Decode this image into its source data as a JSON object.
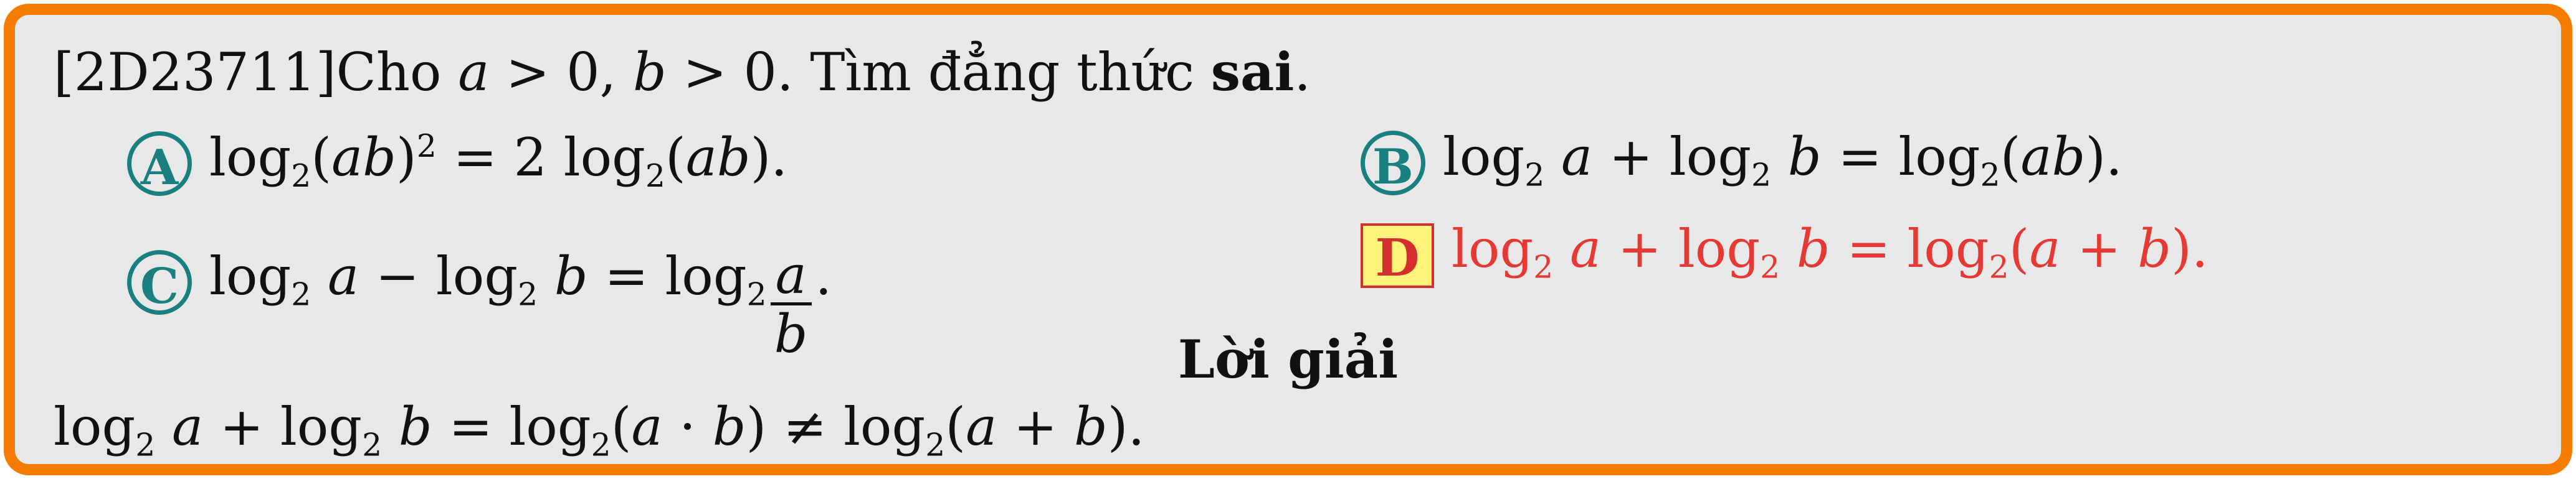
{
  "question": {
    "id": "[2D23711]",
    "intro": "Cho ",
    "a": "a",
    "gt": " > 0, ",
    "b": "b",
    "gt2": " > 0. Tìm đẳng thức ",
    "bold_word": "sai",
    "end": "."
  },
  "options": {
    "a": {
      "label": "A",
      "log": "log",
      "sub": "2",
      "p1": "(",
      "ab": "ab",
      "p2": ")",
      "sup": "2",
      "eq": " = 2 ",
      "log2": "log",
      "sub2": "2",
      "p3": "(",
      "ab2": "ab",
      "p4": ")."
    },
    "b": {
      "label": "B",
      "log1": "log",
      "sub1": "2",
      "a": "a",
      "plus": " + ",
      "log2": "log",
      "sub2": "2",
      "b": "b",
      "eq": " = ",
      "log3": "log",
      "sub3": "2",
      "p1": "(",
      "ab": "ab",
      "p2": ")."
    },
    "c": {
      "label": "C",
      "log1": "log",
      "sub1": "2",
      "a": "a",
      "minus": " − ",
      "log2": "log",
      "sub2": "2",
      "b": "b",
      "eq": " = ",
      "log3": "log",
      "sub3": "2",
      "num": "a",
      "den": "b",
      "end": "."
    },
    "d": {
      "label": "D",
      "log1": "log",
      "sub1": "2",
      "a": "a",
      "plus": " + ",
      "log2": "log",
      "sub2": "2",
      "b": "b",
      "eq": " = ",
      "log3": "log",
      "sub3": "2",
      "p1": "(",
      "a2": "a",
      "plus2": " + ",
      "b2": "b",
      "p2": ")."
    }
  },
  "solution": {
    "title": "Lời giải",
    "log1": "log",
    "sub1": "2",
    "a": "a",
    "plus": " + ",
    "log2": "log",
    "sub2": "2",
    "b": "b",
    "eq": " = ",
    "log3": "log",
    "sub3": "2",
    "p1": "(",
    "a2": "a",
    "dot": " · ",
    "b2": "b",
    "p2": ")",
    "neq": " ≠ ",
    "log4": "log",
    "sub4": "2",
    "p3": "(",
    "a3": "a",
    "plus2": " + ",
    "b3": "b",
    "p4": ")."
  },
  "colors": {
    "border": "#f57c00",
    "background": "#e8e8e8",
    "option_circle": "#1a7f7f",
    "answer_red": "#e53935",
    "answer_box": "#fff37a"
  }
}
